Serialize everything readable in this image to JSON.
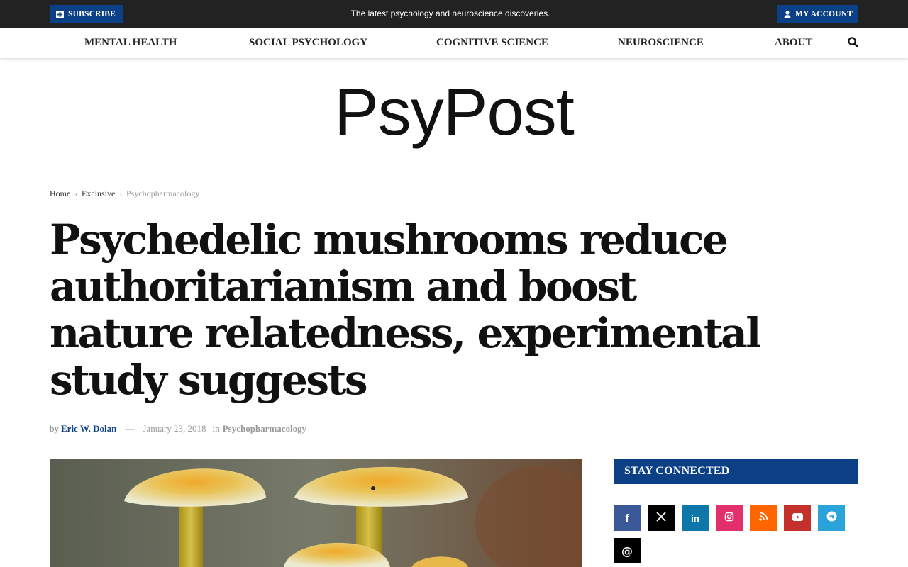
{
  "topbar": {
    "subscribe_label": "SUBSCRIBE",
    "tagline": "The latest psychology and neuroscience discoveries.",
    "account_label": "MY ACCOUNT"
  },
  "nav": {
    "items": [
      {
        "label": "MENTAL HEALTH"
      },
      {
        "label": "SOCIAL PSYCHOLOGY"
      },
      {
        "label": "COGNITIVE SCIENCE"
      },
      {
        "label": "NEUROSCIENCE"
      },
      {
        "label": "ABOUT"
      }
    ],
    "search_icon": "search-icon"
  },
  "logo": "PsyPost",
  "breadcrumb": {
    "items": [
      "Home",
      "Exclusive",
      "Psychopharmacology"
    ]
  },
  "article": {
    "title": "Psychedelic mushrooms reduce authoritarianism and boost nature relatedness, experimental study suggests",
    "by": "by",
    "author": "Eric W. Dolan",
    "dash": "—",
    "date": "January 23, 2018",
    "in": "in",
    "category": "Psychopharmacology"
  },
  "sidebar": {
    "stay_connected": "STAY CONNECTED",
    "social": [
      {
        "name": "facebook",
        "color": "#3b5998"
      },
      {
        "name": "x",
        "color": "#000000"
      },
      {
        "name": "linkedin",
        "color": "#0e76a8"
      },
      {
        "name": "instagram",
        "color": "#e1306c"
      },
      {
        "name": "rss",
        "color": "#ff6600"
      },
      {
        "name": "youtube",
        "color": "#c4302b"
      },
      {
        "name": "telegram",
        "color": "#2aa3d8"
      },
      {
        "name": "threads",
        "color": "#000000"
      }
    ]
  },
  "colors": {
    "topbar_bg": "#222222",
    "brand_blue": "#0b3f86"
  }
}
